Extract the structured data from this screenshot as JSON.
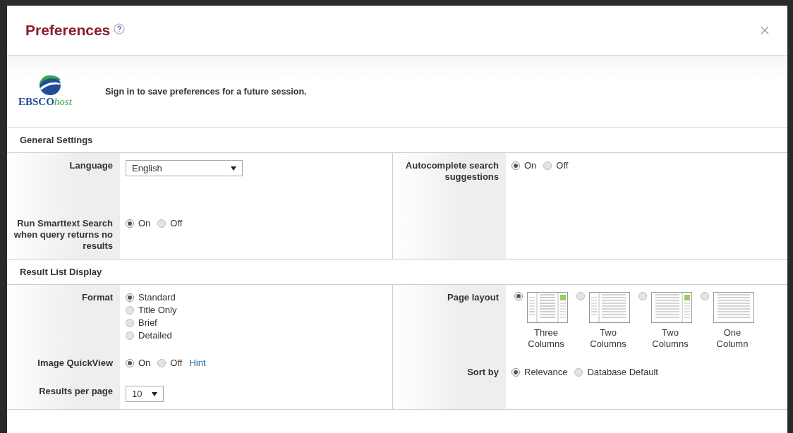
{
  "dialog": {
    "title": "Preferences"
  },
  "logo": {
    "brand": "EBSCO",
    "suffix": "host"
  },
  "sign_in_message": "Sign in to save preferences for a future session.",
  "sections": [
    {
      "title": "General Settings",
      "columns": [
        [
          {
            "kind": "select",
            "label": "Language",
            "value": "English"
          },
          {
            "kind": "radio",
            "label": "Run Smarttext Search when query returns no results",
            "options": [
              {
                "label": "On",
                "selected": true
              },
              {
                "label": "Off",
                "selected": false
              }
            ]
          }
        ],
        [
          {
            "kind": "radio",
            "label": "Autocomplete search suggestions",
            "options": [
              {
                "label": "On",
                "selected": true
              },
              {
                "label": "Off",
                "selected": false
              }
            ]
          }
        ]
      ]
    },
    {
      "title": "Result List Display",
      "columns": [
        [
          {
            "kind": "radio_list",
            "label": "Format",
            "options": [
              {
                "label": "Standard",
                "selected": true
              },
              {
                "label": "Title Only",
                "selected": false
              },
              {
                "label": "Brief",
                "selected": false
              },
              {
                "label": "Detailed",
                "selected": false
              }
            ]
          },
          {
            "kind": "radio",
            "label": "Image QuickView",
            "options": [
              {
                "label": "On",
                "selected": true
              },
              {
                "label": "Off",
                "selected": false
              }
            ],
            "link": "Hint"
          },
          {
            "kind": "select",
            "label": "Results per page",
            "value": "10"
          }
        ],
        [
          {
            "kind": "layout",
            "label": "Page layout",
            "options": [
              {
                "label": "Three Columns",
                "selected": true,
                "left": true,
                "right": true
              },
              {
                "label": "Two Columns",
                "selected": false,
                "left": true,
                "right": false
              },
              {
                "label": "Two Columns",
                "selected": false,
                "left": false,
                "right": true
              },
              {
                "label": "One Column",
                "selected": false,
                "left": false,
                "right": false
              }
            ]
          },
          {
            "kind": "radio",
            "label": "Sort by",
            "options": [
              {
                "label": "Relevance",
                "selected": true
              },
              {
                "label": "Database Default",
                "selected": false
              }
            ]
          }
        ]
      ]
    }
  ]
}
